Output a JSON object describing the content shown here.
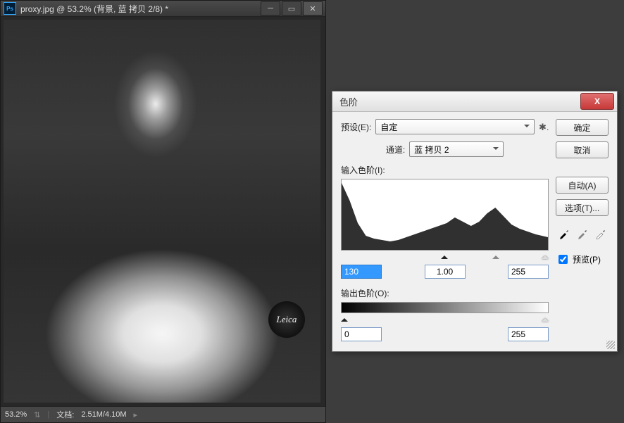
{
  "doc": {
    "title": "proxy.jpg @ 53.2% (背景, 蓝 拷贝 2/8) *",
    "zoom": "53.2%",
    "fileinfo_label": "文档:",
    "fileinfo": "2.51M/4.10M",
    "badge": "Leica"
  },
  "dialog": {
    "title": "色阶",
    "preset_label": "预设(E):",
    "preset_value": "自定",
    "channel_label": "通道:",
    "channel_value": "蓝 拷贝 2",
    "input_label": "输入色阶(I):",
    "output_label": "输出色阶(O):",
    "in_black": "130",
    "in_gamma": "1.00",
    "in_white": "255",
    "out_black": "0",
    "out_white": "255",
    "ok": "确定",
    "cancel": "取消",
    "auto": "自动(A)",
    "options": "选项(T)...",
    "preview": "预览(P)"
  },
  "chart_data": {
    "type": "area",
    "title": "输入色阶(I)",
    "xlabel": "",
    "ylabel": "",
    "x": [
      0,
      10,
      20,
      30,
      40,
      50,
      60,
      70,
      80,
      90,
      100,
      110,
      120,
      130,
      140,
      150,
      160,
      170,
      180,
      190,
      200,
      210,
      220,
      230,
      240,
      255
    ],
    "values": [
      95,
      70,
      38,
      20,
      16,
      14,
      12,
      14,
      18,
      22,
      26,
      30,
      34,
      38,
      46,
      40,
      34,
      40,
      52,
      60,
      48,
      36,
      30,
      26,
      22,
      18
    ],
    "xlim": [
      0,
      255
    ],
    "ylim": [
      0,
      100
    ]
  }
}
